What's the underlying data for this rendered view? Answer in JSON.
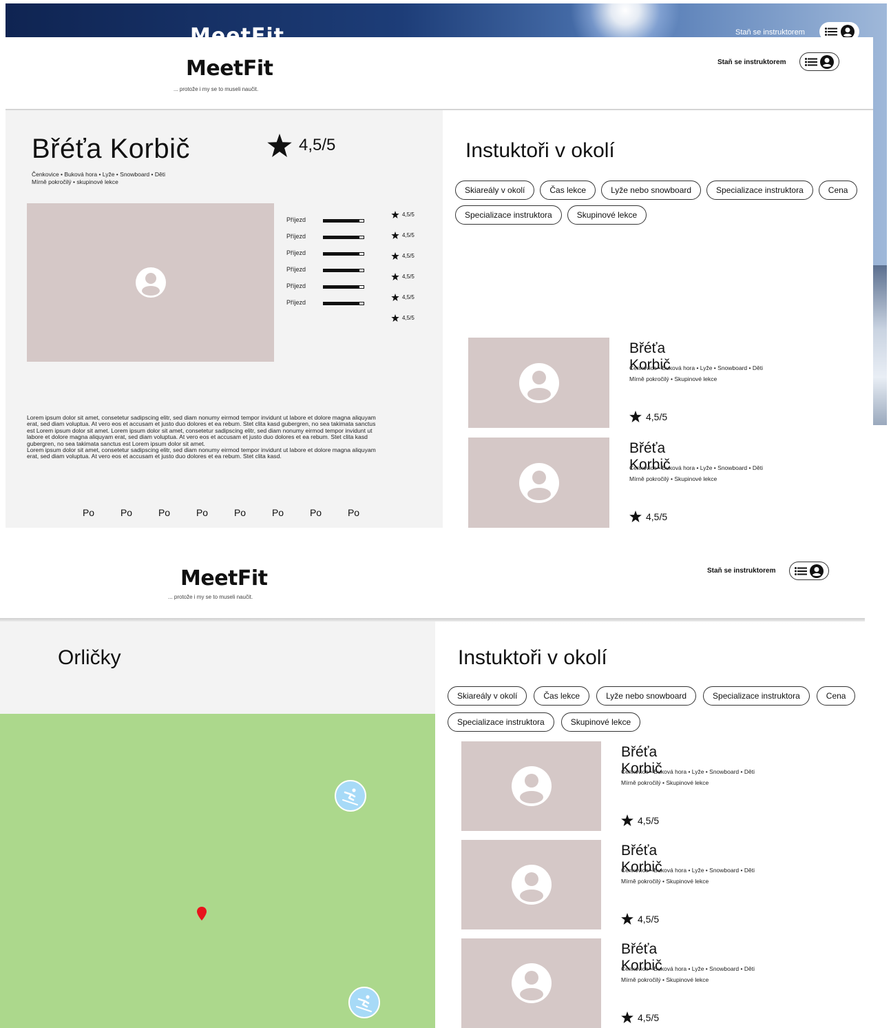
{
  "app": {
    "logo": "MeetFit",
    "tagline": "... protože i my se to museli naučit.",
    "become_instructor": "Staň se instruktorem"
  },
  "colors": {
    "photo_placeholder": "#d5c8c7",
    "map_green": "#acd88c",
    "ski_marker": "#a7daf7",
    "pin_red": "#e8141c"
  },
  "profile": {
    "name": "Břéťa Korbič",
    "rating": "4,5/5",
    "meta_line1": "Čenkovice • Buková hora • Lyže • Snowboard • Děti",
    "meta_line2": "Mírně pokročilý • skupinové lekce",
    "ratings": [
      {
        "label": "Příjezd",
        "value": "4,5/5",
        "fill": 0.9
      },
      {
        "label": "Příjezd",
        "value": "4,5/5",
        "fill": 0.9
      },
      {
        "label": "Příjezd",
        "value": "4,5/5",
        "fill": 0.9
      },
      {
        "label": "Příjezd",
        "value": "4,5/5",
        "fill": 0.9
      },
      {
        "label": "Příjezd",
        "value": "4,5/5",
        "fill": 0.9
      },
      {
        "label": "Příjezd",
        "value": "4,5/5",
        "fill": 0.9
      }
    ],
    "description_p1": "Lorem ipsum dolor sit amet, consetetur sadipscing elitr, sed diam nonumy eirmod tempor invidunt ut labore et dolore magna aliquyam erat, sed diam voluptua. At vero eos et accusam et justo duo dolores et ea rebum. Stet clita kasd gubergren, no sea takimata sanctus est Lorem ipsum dolor sit amet. Lorem ipsum dolor sit amet, consetetur sadipscing elitr, sed diam nonumy eirmod tempor invidunt ut labore et dolore magna aliquyam erat, sed diam voluptua. At vero eos et accusam et justo duo dolores et ea rebum. Stet clita kasd gubergren, no sea takimata sanctus est Lorem ipsum dolor sit amet.",
    "description_p2": "Lorem ipsum dolor sit amet, consetetur sadipscing elitr, sed diam nonumy eirmod tempor invidunt ut labore et dolore magna aliquyam erat, sed diam voluptua. At vero eos et accusam et justo duo dolores et ea rebum. Stet clita kasd.",
    "days": [
      "Po",
      "Po",
      "Po",
      "Po",
      "Po",
      "Po",
      "Po",
      "Po"
    ]
  },
  "nearby": {
    "title": "Instuktoři v okolí",
    "filters": [
      "Skiareály v okolí",
      "Čas lekce",
      "Lyže nebo snowboard",
      "Specializace instruktora",
      "Cena",
      "Specializace instruktora",
      "Skupinové lekce"
    ],
    "cards_frame1": [
      {
        "name": "Břéťa Korbič",
        "meta1": "Čenkovice • Buková hora • Lyže • Snowboard • Děti",
        "meta2": "Mírně pokročilý • Skupinové lekce",
        "rating": "4,5/5"
      },
      {
        "name": "Břéťa Korbič",
        "meta1": "Čenkovice • Buková hora • Lyže • Snowboard • Děti",
        "meta2": "Mírně pokročilý • Skupinové lekce",
        "rating": "4,5/5"
      }
    ],
    "cards_frame2": [
      {
        "name": "Břéťa Korbič",
        "meta1": "Čenkovice • Buková hora • Lyže • Snowboard • Děti",
        "meta2": "Mírně pokročilý • Skupinové lekce",
        "rating": "4,5/5"
      },
      {
        "name": "Břéťa Korbič",
        "meta1": "Čenkovice • Buková hora • Lyže • Snowboard • Děti",
        "meta2": "Mírně pokročilý • Skupinové lekce",
        "rating": "4,5/5"
      },
      {
        "name": "Břéťa Korbič",
        "meta1": "Čenkovice • Buková hora • Lyže • Snowboard • Děti",
        "meta2": "Mírně pokročilý • Skupinové lekce",
        "rating": "4,5/5"
      }
    ]
  },
  "map": {
    "region": "Orličky",
    "markers": [
      "ski-resort-icon",
      "ski-resort-icon",
      "location-pin-icon"
    ]
  }
}
